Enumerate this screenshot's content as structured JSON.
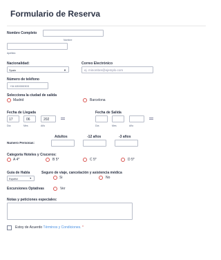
{
  "form": {
    "title": "Formulario de Reserva",
    "full_name": {
      "label": "Nombre Completo",
      "first_sub": "Nombre",
      "last_sub": "Apellido"
    },
    "nationality": {
      "label": "Nacionalidad:",
      "value": "Spain"
    },
    "email": {
      "label": "Correo Electrónico",
      "placeholder": "ej. minombre@ejemplo.com"
    },
    "phone": {
      "label": "Número de teléfono",
      "value": "+34 630000303"
    },
    "departure_city": {
      "label": "Selecciona la ciudad de salida",
      "options": [
        "Madrid",
        "Barcelona"
      ]
    },
    "arrival_date": {
      "label": "Fecha de Llegada",
      "day": "17",
      "month": "06",
      "year": "202",
      "subs": [
        "Día",
        "Mes",
        "Año"
      ]
    },
    "departure_date": {
      "label": "Fecha de Salida",
      "subs": [
        "Día",
        "Mes",
        "Año"
      ]
    },
    "people": {
      "label": "Numero Personas:",
      "cols": [
        "Adultos",
        "-12 años",
        "-3 años"
      ]
    },
    "category": {
      "label": "Categoría Hoteles y Cruceros:",
      "options": [
        "A 4*",
        "B 5*",
        "C 5*",
        "D 5*"
      ]
    },
    "guide": {
      "label": "Guia de Habla",
      "value": "Español"
    },
    "insurance": {
      "label": "Seguro de viaje, cancelación y asistencia médica",
      "options": [
        "Si",
        "No"
      ]
    },
    "excursions": {
      "label": "Excursiones Optativas",
      "option": "Ver"
    },
    "notes": {
      "label": "Notas y peticiones especiales:"
    },
    "terms": {
      "prefix": "Estoy de Acuerdo",
      "link": "Términos y Condiciones.",
      "required_mark": "*"
    }
  },
  "colors": {
    "accent": "#d9534f",
    "link": "#4a90e2",
    "text": "#2c3345"
  }
}
